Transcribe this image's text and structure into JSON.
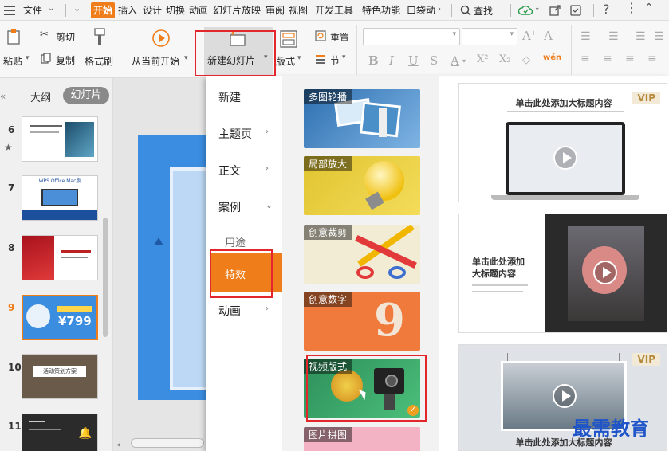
{
  "menubar": {
    "file": "文件",
    "tabs": [
      "开始",
      "插入",
      "设计",
      "切换",
      "动画",
      "幻灯片放映",
      "审阅",
      "视图",
      "开发工具",
      "特色功能",
      "口袋动"
    ],
    "search": "查找"
  },
  "ribbon": {
    "paste": "粘贴",
    "cut": "剪切",
    "copy": "复制",
    "format_painter": "格式刷",
    "from_current": "从当前开始",
    "new_slide": "新建幻灯片",
    "layout": "版式",
    "reset": "重置",
    "section": "节"
  },
  "left_panel": {
    "tabs": [
      "大纲",
      "幻灯片"
    ],
    "thumbs": [
      {
        "num": "6",
        "text": ""
      },
      {
        "num": "7",
        "text": "WPS Office Mac版"
      },
      {
        "num": "8",
        "text": ""
      },
      {
        "num": "9",
        "text": "¥799"
      },
      {
        "num": "10",
        "text": "活动策划方案"
      },
      {
        "num": "11",
        "text": ""
      }
    ]
  },
  "dropdown": {
    "categories": [
      "新建",
      "主题页",
      "正文",
      "案例",
      "用途",
      "特效",
      "动画"
    ],
    "effect_cards": [
      "多图轮播",
      "局部放大",
      "创意裁剪",
      "创意数字",
      "视频版式",
      "图片拼图"
    ],
    "templates": [
      {
        "title": "单击此处添加大标题内容",
        "vip": "VIP"
      },
      {
        "title": "单击此处添加\n大标题内容"
      },
      {
        "title": "单击此处添加大标题内容",
        "vip": "VIP"
      }
    ]
  },
  "watermark": "最需教育",
  "colors": {
    "accent": "#ee7d1a",
    "highlight_box": "#e3262c"
  }
}
